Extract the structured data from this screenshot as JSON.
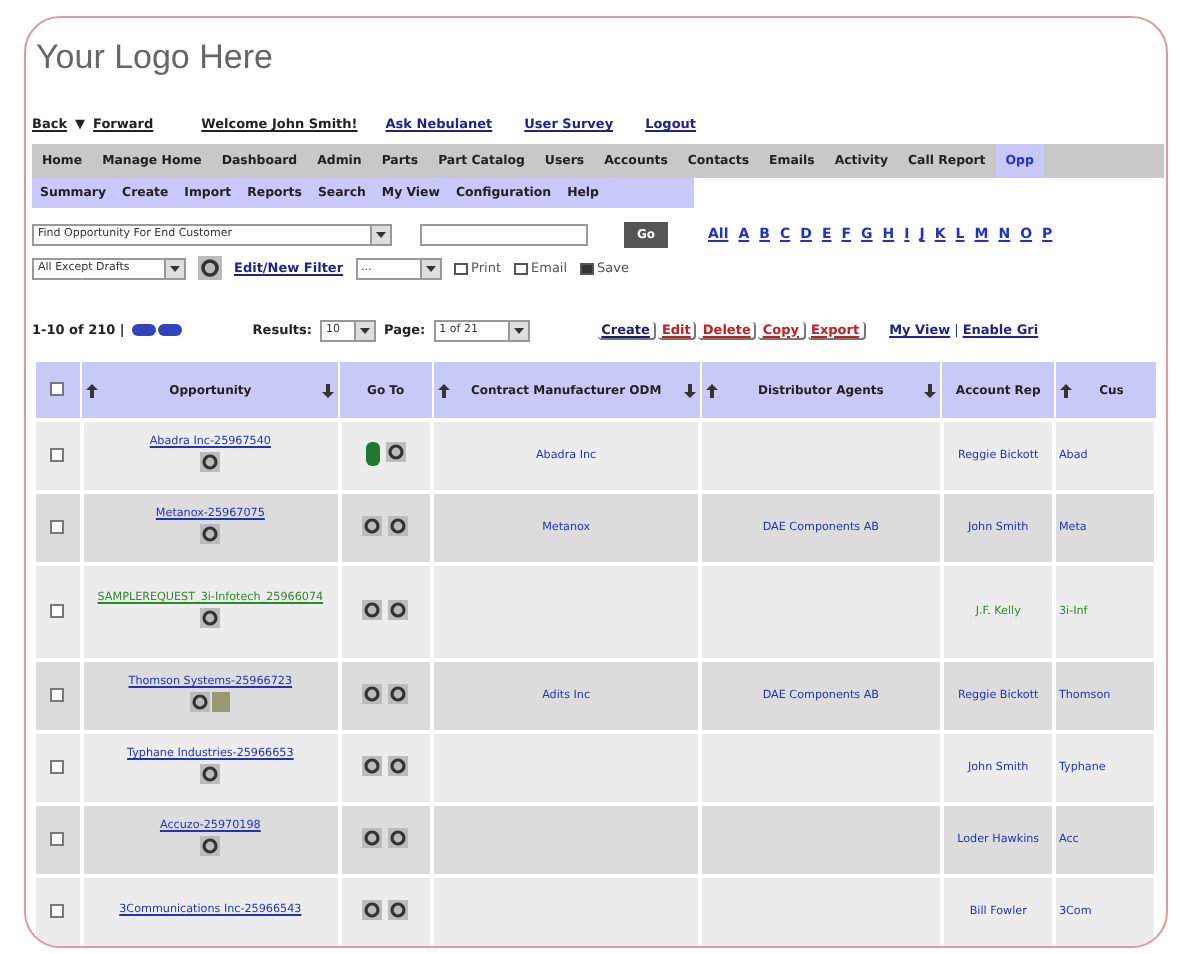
{
  "logo": "Your Logo Here",
  "history": {
    "back": "Back",
    "menu": "▼",
    "forward": "Forward"
  },
  "user_links": [
    {
      "label": "Welcome John Smith!",
      "kind": "greeting"
    },
    {
      "label": "Ask Nebulanet",
      "kind": "link"
    },
    {
      "label": "User Survey",
      "kind": "link"
    },
    {
      "label": "Logout",
      "kind": "link"
    }
  ],
  "main_tabs": [
    {
      "label": "Home",
      "selected": false
    },
    {
      "label": "Manage Home",
      "selected": false
    },
    {
      "label": "Dashboard",
      "selected": false
    },
    {
      "label": "Admin",
      "selected": false
    },
    {
      "label": "Parts",
      "selected": false
    },
    {
      "label": "Part Catalog",
      "selected": false
    },
    {
      "label": "Users",
      "selected": false
    },
    {
      "label": "Accounts",
      "selected": false
    },
    {
      "label": "Contacts",
      "selected": false
    },
    {
      "label": "Emails",
      "selected": false
    },
    {
      "label": "Activity",
      "selected": false
    },
    {
      "label": "Call Report",
      "selected": false
    },
    {
      "label": "Opp",
      "selected": true
    }
  ],
  "sub_tabs": [
    "Summary",
    "Create",
    "Import",
    "Reports",
    "Search",
    "My View",
    "Configuration",
    "Help"
  ],
  "search": {
    "mode": "Find Opportunity For End Customer",
    "button": "Go"
  },
  "letters": [
    "All",
    "A",
    "B",
    "C",
    "D",
    "E",
    "F",
    "G",
    "H",
    "I",
    "J",
    "K",
    "L",
    "M",
    "N",
    "O",
    "P"
  ],
  "filter": {
    "view": "All Except Drafts",
    "edit_link": "Edit/New Filter",
    "saved": "...",
    "actions": [
      "Print",
      "Email",
      "Save"
    ]
  },
  "pager": {
    "range": "1-10 of 210 |",
    "results_label": "Results:",
    "results": "10",
    "page_label": "Page:",
    "page": "1 of 21",
    "actions": [
      {
        "label": "Create",
        "color": "#1a1a6e"
      },
      {
        "label": "Edit",
        "color": "#c02020"
      },
      {
        "label": "Delete",
        "color": "#c02020"
      },
      {
        "label": "Copy",
        "color": "#c02020"
      },
      {
        "label": "Export",
        "color": "#c02020"
      }
    ],
    "view_links": [
      "My View",
      "|",
      "Enable Gri"
    ]
  },
  "table": {
    "select_all": {
      "checked": false
    },
    "columns": [
      {
        "label": "Opportunity",
        "sortable": true
      },
      {
        "label": "Go To",
        "sortable": false
      },
      {
        "label": "Contract Manufacturer ODM",
        "sortable": true
      },
      {
        "label": "Distributor Agents",
        "sortable": true
      },
      {
        "label": "Account Rep",
        "sortable": false
      },
      {
        "label": "Cus",
        "sortable": true
      }
    ],
    "rows": [
      {
        "checked": false,
        "opportunity": "Abadra Inc-25967540",
        "kind": "standard",
        "icons": [
          {
            "kind": "gear"
          }
        ],
        "goto_status": true,
        "contract": "Abadra Inc",
        "distributor": "",
        "rep": "Reggie Bickott",
        "customer": "Abad"
      },
      {
        "checked": false,
        "opportunity": "Metanox-25967075",
        "kind": "standard",
        "icons": [
          {
            "kind": "gear"
          }
        ],
        "goto_status": false,
        "contract": "Metanox",
        "distributor": "DAE Components AB",
        "rep": "John Smith",
        "customer": "Meta"
      },
      {
        "checked": false,
        "opportunity": "SAMPLEREQUEST_3i-Infotech_25966074",
        "kind": "sample",
        "icons": [
          {
            "kind": "gear"
          }
        ],
        "goto_status": false,
        "contract": "",
        "distributor": "",
        "rep": "J.F. Kelly",
        "customer": "3i-Inf"
      },
      {
        "checked": false,
        "opportunity": "Thomson Systems-25966723",
        "kind": "standard",
        "icons": [
          {
            "kind": "gear"
          },
          {
            "kind": "note"
          }
        ],
        "goto_status": false,
        "contract": "Adits Inc",
        "distributor": "DAE Components AB",
        "rep": "Reggie Bickott",
        "customer": "Thomson"
      },
      {
        "checked": false,
        "opportunity": "Typhane Industries-25966653",
        "kind": "standard",
        "icons": [
          {
            "kind": "gear"
          }
        ],
        "goto_status": false,
        "contract": "",
        "distributor": "",
        "rep": "John Smith",
        "customer": "Typhane"
      },
      {
        "checked": false,
        "opportunity": "Accuzo-25970198",
        "kind": "standard",
        "icons": [
          {
            "kind": "gear"
          }
        ],
        "goto_status": false,
        "contract": "",
        "distributor": "",
        "rep": "Loder Hawkins",
        "customer": "Acc"
      },
      {
        "checked": false,
        "opportunity": "3Communications Inc-25966543",
        "kind": "standard",
        "goto_status": false,
        "contract": "",
        "distributor": "",
        "rep": "Bill Fowler",
        "customer": "3Com"
      }
    ]
  }
}
